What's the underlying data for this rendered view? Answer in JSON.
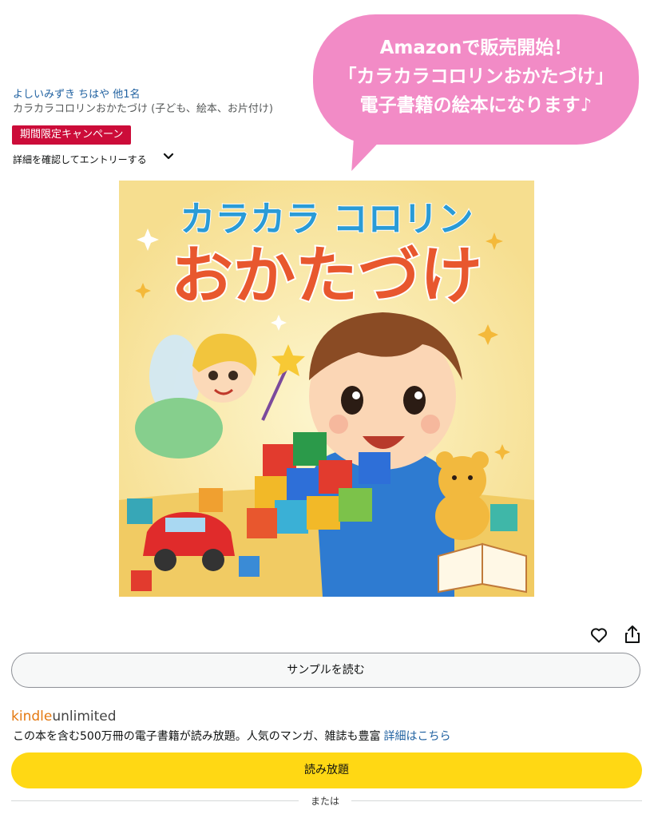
{
  "promo": {
    "line1": "Amazonで販売開始！",
    "line2": "「カラカラコロリンおかたづけ」",
    "line3": "電子書籍の絵本になります♪",
    "color": "#f28bc6"
  },
  "book": {
    "authors": "よしいみずき ちはや 他1名",
    "title": "カラカラコロリンおかたづけ (子ども、絵本、お片付け)"
  },
  "campaign": {
    "badge": "期間限定キャンペーン",
    "entry": "詳細を確認してエントリーする",
    "badge_color": "#cc0c39"
  },
  "cover": {
    "title_line1": "カラカラ コロリン",
    "title_line2": "おかたづけ"
  },
  "actions": {
    "wishlist_icon": "heart-icon",
    "share_icon": "share-icon",
    "sample_label": "サンプルを読む"
  },
  "kindle_unlimited": {
    "logo_kindle": "kindle",
    "logo_unlimited": "unlimited",
    "description": "この本を含む500万冊の電子書籍が読み放題。人気のマンガ、雑誌も豊富",
    "details_link": "詳細はこちら",
    "read_button": "読み放題",
    "button_color": "#ffd814"
  },
  "separator": {
    "label": "または"
  }
}
